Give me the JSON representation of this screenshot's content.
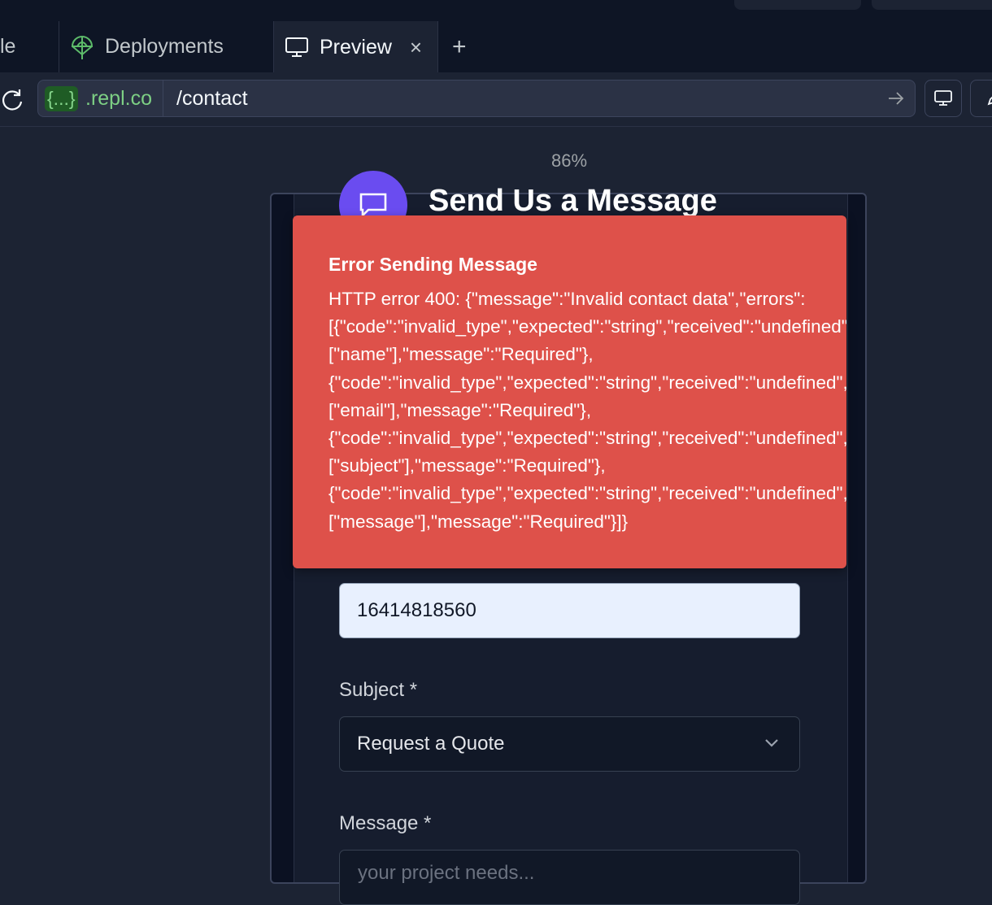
{
  "tabs": [
    {
      "label": "le"
    },
    {
      "label": "Deployments",
      "icon": "deployments-icon"
    },
    {
      "label": "Preview",
      "icon": "monitor-icon",
      "close": "×"
    }
  ],
  "new_tab_label": "+",
  "address": {
    "domain_chip": "{...}",
    "domain_rest": ".repl.co",
    "path": "/contact"
  },
  "zoom": "86%",
  "form": {
    "title": "Send Us a Message",
    "phone_value": "16414818560",
    "subject_label": "Subject *",
    "subject_value": "Request a Quote",
    "message_label": "Message *",
    "message_placeholder": "your project needs..."
  },
  "toast": {
    "title": "Error Sending Message",
    "lines": [
      "HTTP error 400: {\"message\":\"Invalid contact data\",\"errors\":",
      "[{\"code\":\"invalid_type\",\"expected\":\"string\",\"received\":\"undefined\",\"path\":",
      "[\"name\"],\"message\":\"Required\"},",
      "{\"code\":\"invalid_type\",\"expected\":\"string\",\"received\":\"undefined\",\"path\":",
      "[\"email\"],\"message\":\"Required\"},",
      "{\"code\":\"invalid_type\",\"expected\":\"string\",\"received\":\"undefined\",\"path\":",
      "[\"subject\"],\"message\":\"Required\"},",
      "{\"code\":\"invalid_type\",\"expected\":\"string\",\"received\":\"undefined\",\"path\":",
      "[\"message\"],\"message\":\"Required\"}]}"
    ]
  },
  "colors": {
    "toast": "#de514a",
    "accent_purple": "#6a4cf0",
    "domain_green": "#7dcf84"
  }
}
